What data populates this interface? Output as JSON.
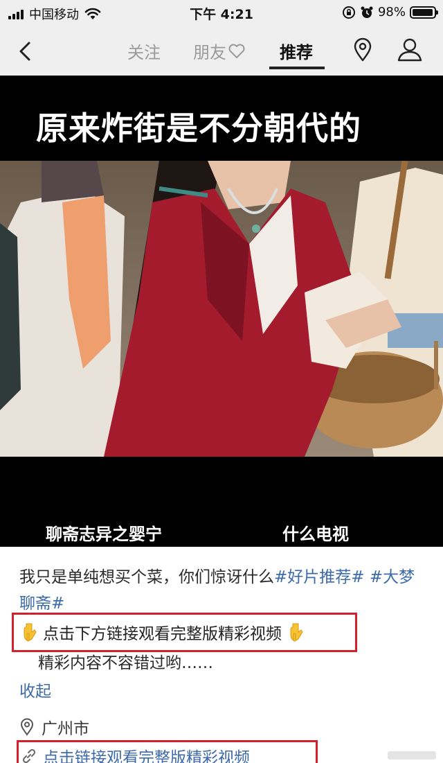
{
  "status_bar": {
    "carrier": "中国移动",
    "time": "下午 4:21",
    "battery_percent": "98%",
    "battery_level": 0.98
  },
  "nav": {
    "tabs": [
      {
        "label": "关注",
        "active": false
      },
      {
        "label": "朋友",
        "active": false
      },
      {
        "label": "推荐",
        "active": true
      }
    ]
  },
  "video": {
    "caption": "原来炸街是不分朝代的",
    "subtitle_left": "聊斋志异之婴宁",
    "subtitle_right": "什么电视"
  },
  "post": {
    "description": "我只是单纯想买个菜，你们惊讶什么",
    "hashtags": [
      "#好片推荐#",
      "#大梦聊斋#"
    ],
    "promo_text": "点击下方链接观看完整版精彩视频",
    "more_text": "精彩内容不容错过哟……",
    "collapse_label": "收起",
    "location": "广州市",
    "link_text": "点击链接观看完整版精彩视频"
  },
  "colors": {
    "hashtag": "#3d6aa8",
    "highlight_box": "#d3202a",
    "bar_background": "#efefef"
  }
}
